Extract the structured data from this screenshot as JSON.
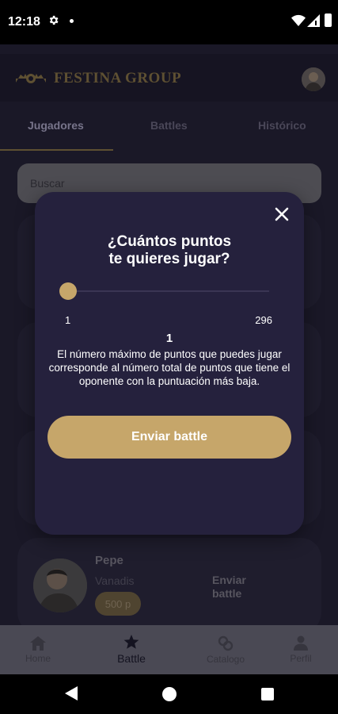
{
  "status_bar": {
    "time": "12:18"
  },
  "header": {
    "brand": "FESTINA GROUP"
  },
  "tabs": [
    {
      "label": "Jugadores",
      "active": true
    },
    {
      "label": "Battles",
      "active": false
    },
    {
      "label": "Histórico",
      "active": false
    }
  ],
  "search": {
    "placeholder": "Buscar"
  },
  "user_card": {
    "name": "Pepe",
    "brand": "Vanadis",
    "points": "500 p",
    "action": "Enviar battle"
  },
  "bottom_nav": [
    {
      "label": "Home",
      "icon": "home-icon"
    },
    {
      "label": "Battle",
      "icon": "star-icon",
      "active": true
    },
    {
      "label": "Catalogo",
      "icon": "catalog-icon"
    },
    {
      "label": "Perfil",
      "icon": "person-icon"
    }
  ],
  "modal": {
    "title_line1": "¿Cuántos puntos",
    "title_line2": "te quieres jugar?",
    "slider": {
      "min": "1",
      "max": "296",
      "value": "1",
      "fraction": 0.0
    },
    "description": "El número máximo de puntos que puedes jugar corresponde al número total de puntos que tiene el oponente con la puntuación más baja.",
    "button": "Enviar battle"
  },
  "colors": {
    "accent": "#c6a66a",
    "modal_bg": "#25213d",
    "app_bg": "#1a1827"
  }
}
